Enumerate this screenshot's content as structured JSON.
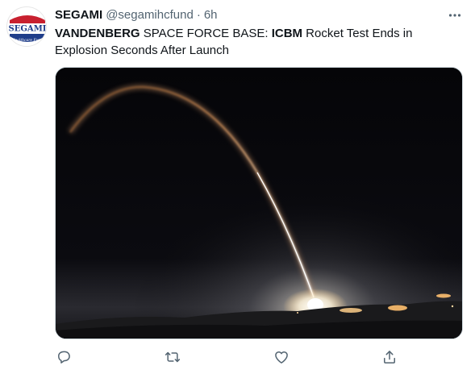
{
  "tweet": {
    "author_name": "SEGAMI",
    "author_handle": "@segamihcfund",
    "separator": "·",
    "timestamp": "6h",
    "avatar": {
      "top_text": "SEGAMI",
      "bottom_text": "Healthcare Fund",
      "colors": {
        "red": "#c8202f",
        "blue": "#1f3d8a",
        "white": "#ffffff"
      }
    },
    "text_parts": [
      "VANDENBERG",
      " SPACE FORCE BASE: ",
      "ICBM",
      " Rocket Test Ends in Explosion Seconds After Launch"
    ],
    "media": {
      "description_icon": "rocket-launch-photo"
    },
    "actions": {
      "reply_icon": "reply-icon",
      "retweet_icon": "retweet-icon",
      "like_icon": "heart-icon",
      "share_icon": "share-icon"
    },
    "icon_color": "#536471"
  }
}
